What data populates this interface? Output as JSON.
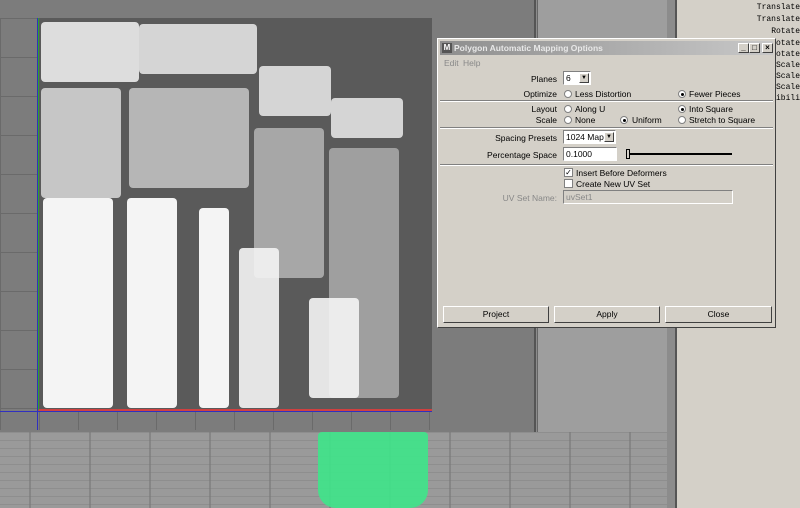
{
  "dialog": {
    "title": "Polygon Automatic Mapping Options",
    "menu": [
      "Edit",
      "Help"
    ],
    "planes": {
      "label": "Planes",
      "value": "6"
    },
    "optimize": {
      "label": "Optimize",
      "options": [
        "Less Distortion",
        "Fewer Pieces"
      ],
      "selected": "Fewer Pieces"
    },
    "layout": {
      "label": "Layout",
      "options": [
        "Along U",
        "Into Square"
      ],
      "selected": "Into Square"
    },
    "scale": {
      "label": "Scale",
      "options": [
        "None",
        "Uniform",
        "Stretch to Square"
      ],
      "selected": "Uniform"
    },
    "spacing_presets": {
      "label": "Spacing Presets",
      "value": "1024 Map"
    },
    "percentage_space": {
      "label": "Percentage Space",
      "value": "0.1000",
      "slider_fraction": 0.0
    },
    "insert_before_deformers": {
      "label": "Insert Before Deformers",
      "checked": true
    },
    "create_new_uv_set": {
      "label": "Create New UV Set",
      "checked": false
    },
    "uv_set_name": {
      "label": "UV Set Name:",
      "value": "uvSet1"
    },
    "buttons": {
      "project": "Project",
      "apply": "Apply",
      "close": "Close"
    }
  },
  "channel_box": [
    "Translate",
    "Translate",
    "Rotate",
    "Rotate",
    "Rotate",
    "Scale",
    "Scale",
    "Scale",
    "ibili"
  ]
}
